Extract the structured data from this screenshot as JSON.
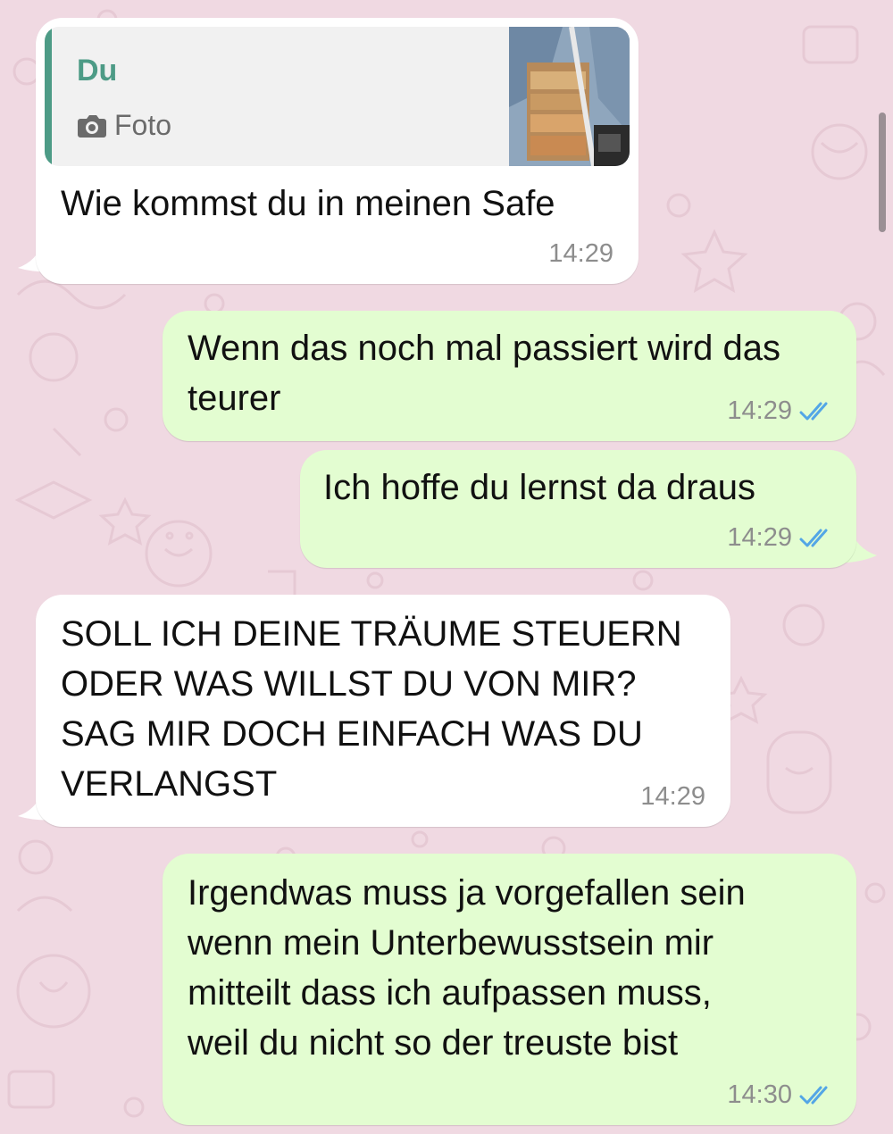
{
  "messages": [
    {
      "direction": "incoming",
      "quote": {
        "author": "Du",
        "type_icon": "camera-icon",
        "type_label": "Foto"
      },
      "text": "Wie kommst du in meinen Safe",
      "time": "14:29"
    },
    {
      "direction": "outgoing",
      "text": "Wenn das noch mal passiert wird das\nteurer",
      "time": "14:29",
      "read": true
    },
    {
      "direction": "outgoing",
      "text": "Ich hoffe du lernst da draus",
      "time": "14:29",
      "read": true
    },
    {
      "direction": "incoming",
      "text": "SOLL ICH DEINE TRÄUME STEUERN\nODER WAS WILLST DU VON MIR?\nSAG MIR DOCH EINFACH WAS DU\nVERLANGST",
      "time": "14:29"
    },
    {
      "direction": "outgoing",
      "text": "Irgendwas muss ja vorgefallen sein\nwenn mein Unterbewusstsein mir\nmitteilt dass ich aufpassen muss,\nweil du nicht so der treuste bist",
      "time": "14:30",
      "read": true
    }
  ],
  "colors": {
    "wallpaper": "#f0d9e2",
    "incoming_bubble": "#ffffff",
    "outgoing_bubble": "#e3fdd1",
    "quote_accent": "#4d9b86",
    "read_ticks": "#53a6e6"
  }
}
